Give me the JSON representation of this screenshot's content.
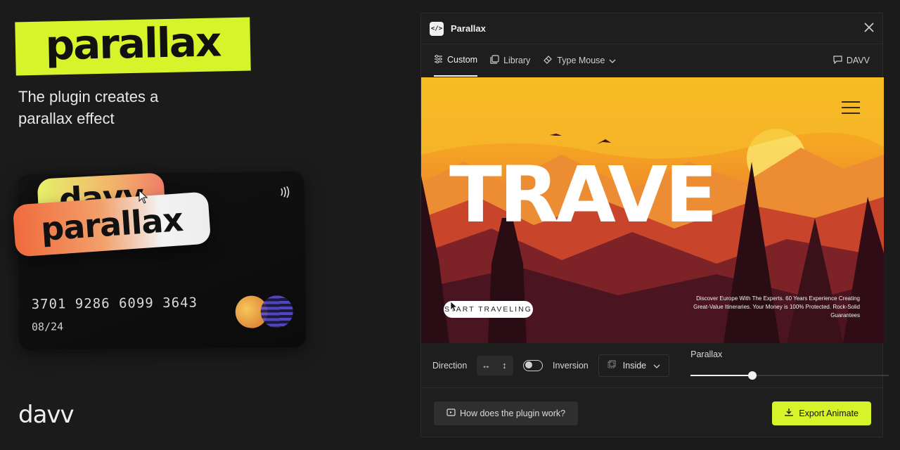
{
  "promo": {
    "headline": "parallax",
    "tagline": "The plugin creates a parallax effect",
    "brand": "davv",
    "accent_color": "#d7f32a"
  },
  "card": {
    "pill_top": "davv",
    "pill_bottom": "parallax",
    "number": "3701 9286 6099 3643",
    "expiry": "08/24",
    "contactless_icon": "contactless-icon"
  },
  "window": {
    "title": "Parallax",
    "app_icon_glyph": "</>",
    "tabs": [
      {
        "label": "Custom",
        "icon": "sliders-icon",
        "active": true
      },
      {
        "label": "Library",
        "icon": "library-icon"
      },
      {
        "label": "Type Mouse",
        "icon": "mouse-type-icon"
      }
    ],
    "account_label": "DAVV"
  },
  "preview": {
    "hero_word": "TRAVE",
    "cta_label": "START TRAVELING",
    "copy": "Discover Europe With The Experts. 60 Years Experience Creating Great-Value Itineraries. Your Money is 100% Protected. Rock-Solid Guarantees"
  },
  "controls": {
    "direction_label": "Direction",
    "direction_horizontal": "↔",
    "direction_vertical": "↕",
    "inversion_label": "Inversion",
    "mode_value": "Inside",
    "parallax_label": "Parallax",
    "parallax_level": 0.31
  },
  "footer": {
    "help_label": "How does the plugin work?",
    "export_label": "Export Animate"
  }
}
